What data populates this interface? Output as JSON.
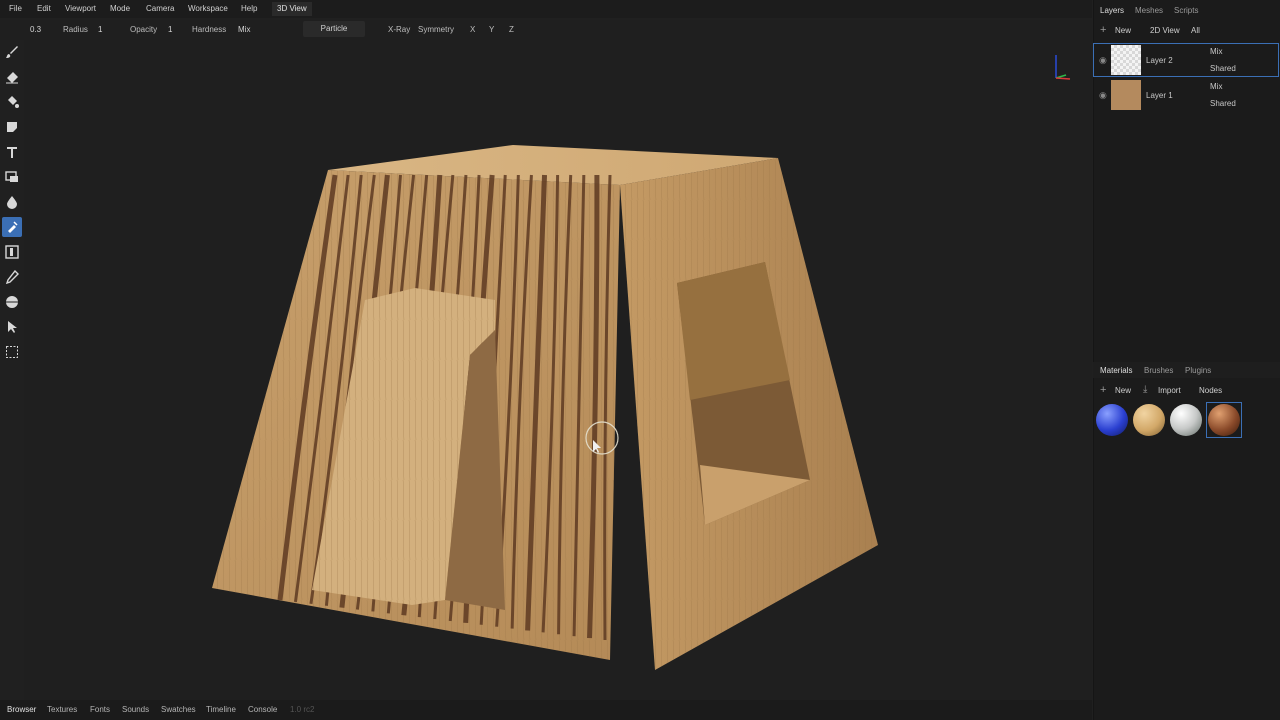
{
  "menu": {
    "items": [
      "File",
      "Edit",
      "Viewport",
      "Mode",
      "Camera",
      "Workspace",
      "Help"
    ],
    "active_tab": "3D View"
  },
  "toolbar": {
    "size_value": "0.3",
    "radius_label": "Radius",
    "radius_value": "1",
    "opacity_label": "Opacity",
    "opacity_value": "1",
    "hardness_label": "Hardness",
    "blend_value": "Mix",
    "particle_label": "Particle",
    "xray_label": "X-Ray",
    "symmetry_label": "Symmetry",
    "axis_x": "X",
    "axis_y": "Y",
    "axis_z": "Z"
  },
  "tools": [
    "brush-icon",
    "eraser-icon",
    "fill-icon",
    "decal-icon",
    "text-icon",
    "clone-icon",
    "blur-icon",
    "smudge-icon",
    "bake-icon",
    "picker-icon",
    "material-picker-icon",
    "cursor-icon",
    "selection-icon"
  ],
  "active_tool_index": 7,
  "layers_panel": {
    "tabs": [
      "Layers",
      "Meshes",
      "Scripts"
    ],
    "new_label": "New",
    "view_label": "2D View",
    "filter_label": "All",
    "layers": [
      {
        "name": "Layer 2",
        "blend": "Mix",
        "mode": "Shared"
      },
      {
        "name": "Layer 1",
        "blend": "Mix",
        "mode": "Shared"
      }
    ]
  },
  "materials_panel": {
    "tabs": [
      "Materials",
      "Brushes",
      "Plugins"
    ],
    "new_label": "New",
    "import_label": "Import",
    "nodes_label": "Nodes",
    "swatch_colors": [
      "#2a3fd0",
      "#d2a868",
      "#c7c9c8",
      "#8a4a2a"
    ],
    "selected_index": 3
  },
  "bottom_tabs": [
    "Browser",
    "Textures",
    "Fonts",
    "Sounds",
    "Swatches",
    "Timeline",
    "Console"
  ],
  "version": "1.0 rc2",
  "colors": {
    "accent": "#3b6fb5",
    "wood": "#c9a272",
    "wood_dark": "#5e3a22"
  }
}
